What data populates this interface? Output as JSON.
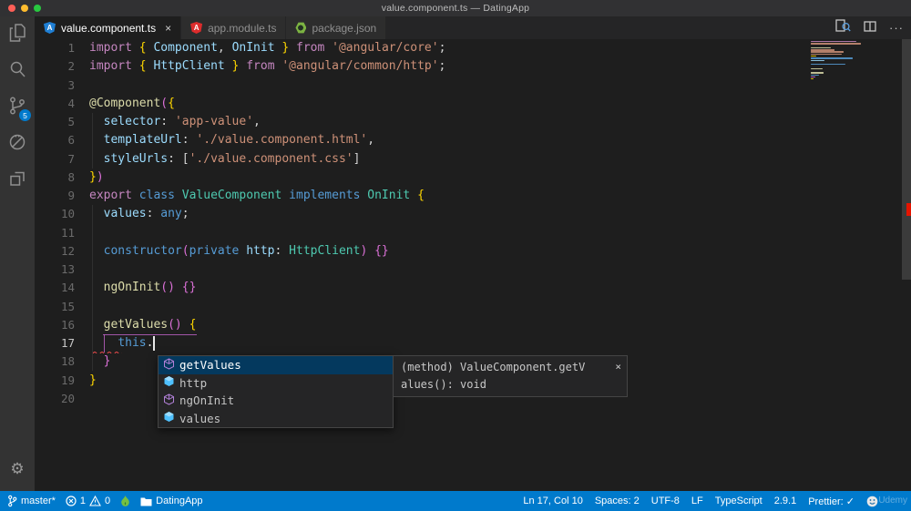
{
  "window": {
    "title": "value.component.ts — DatingApp"
  },
  "activity_bar": {
    "items": [
      {
        "name": "explorer"
      },
      {
        "name": "search"
      },
      {
        "name": "source-control",
        "badge": "5"
      },
      {
        "name": "debug"
      },
      {
        "name": "extensions"
      }
    ]
  },
  "tabs": [
    {
      "label": "value.component.ts",
      "close": "×",
      "active": true,
      "icon": "angular-blue",
      "icon_color": "#1f7fd4",
      "icon_letter": "A"
    },
    {
      "label": "app.module.ts",
      "active": false,
      "icon": "angular-red",
      "icon_color": "#dd2c2c",
      "icon_letter": "A"
    },
    {
      "label": "package.json",
      "active": false,
      "icon": "npm-green"
    }
  ],
  "editor_actions": {
    "more": "···"
  },
  "code": {
    "lines": [
      {
        "n": 1,
        "t": [
          [
            "kw",
            "import "
          ],
          [
            "b1",
            "{ "
          ],
          [
            "id",
            "Component"
          ],
          [
            "pl",
            ", "
          ],
          [
            "id",
            "OnInit"
          ],
          [
            "b1",
            " }"
          ],
          [
            "kw",
            " from "
          ],
          [
            "st",
            "'@angular/core'"
          ],
          [
            "pl",
            ";"
          ]
        ]
      },
      {
        "n": 2,
        "t": [
          [
            "kw",
            "import "
          ],
          [
            "b1",
            "{ "
          ],
          [
            "id",
            "HttpClient"
          ],
          [
            "b1",
            " }"
          ],
          [
            "kw",
            " from "
          ],
          [
            "st",
            "'@angular/common/http'"
          ],
          [
            "pl",
            ";"
          ]
        ]
      },
      {
        "n": 3,
        "t": []
      },
      {
        "n": 4,
        "t": [
          [
            "fn",
            "@Component"
          ],
          [
            "b2",
            "("
          ],
          [
            "b1",
            "{"
          ]
        ]
      },
      {
        "n": 5,
        "t": [
          [
            "pl",
            "  "
          ],
          [
            "id",
            "selector"
          ],
          [
            "pl",
            ": "
          ],
          [
            "st",
            "'app-value'"
          ],
          [
            "pl",
            ","
          ]
        ]
      },
      {
        "n": 6,
        "t": [
          [
            "pl",
            "  "
          ],
          [
            "id",
            "templateUrl"
          ],
          [
            "pl",
            ": "
          ],
          [
            "st",
            "'./value.component.html'"
          ],
          [
            "pl",
            ","
          ]
        ]
      },
      {
        "n": 7,
        "t": [
          [
            "pl",
            "  "
          ],
          [
            "id",
            "styleUrls"
          ],
          [
            "pl",
            ": ["
          ],
          [
            "st",
            "'./value.component.css'"
          ],
          [
            "pl",
            "]"
          ]
        ]
      },
      {
        "n": 8,
        "t": [
          [
            "b1",
            "}"
          ],
          [
            "b2",
            ")"
          ]
        ]
      },
      {
        "n": 9,
        "t": [
          [
            "kw",
            "export "
          ],
          [
            "k2",
            "class "
          ],
          [
            "ty",
            "ValueComponent "
          ],
          [
            "k2",
            "implements "
          ],
          [
            "ty",
            "OnInit "
          ],
          [
            "b1",
            "{"
          ]
        ]
      },
      {
        "n": 10,
        "t": [
          [
            "pl",
            "  "
          ],
          [
            "id",
            "values"
          ],
          [
            "pl",
            ": "
          ],
          [
            "k2",
            "any"
          ],
          [
            "pl",
            ";"
          ]
        ]
      },
      {
        "n": 11,
        "t": []
      },
      {
        "n": 12,
        "t": [
          [
            "pl",
            "  "
          ],
          [
            "k2",
            "constructor"
          ],
          [
            "b2",
            "("
          ],
          [
            "k2",
            "private "
          ],
          [
            "id",
            "http"
          ],
          [
            "pl",
            ": "
          ],
          [
            "ty",
            "HttpClient"
          ],
          [
            "b2",
            ")"
          ],
          [
            "pl",
            " "
          ],
          [
            "b2",
            "{}"
          ]
        ]
      },
      {
        "n": 13,
        "t": []
      },
      {
        "n": 14,
        "t": [
          [
            "pl",
            "  "
          ],
          [
            "fn",
            "ngOnInit"
          ],
          [
            "b2",
            "()"
          ],
          [
            "pl",
            " "
          ],
          [
            "b2",
            "{}"
          ]
        ]
      },
      {
        "n": 15,
        "t": []
      },
      {
        "n": 16,
        "t": [
          [
            "pl",
            "  "
          ],
          [
            "fn",
            "getValues"
          ],
          [
            "b2",
            "()"
          ],
          [
            "pl",
            " "
          ],
          [
            "b1",
            "{"
          ]
        ]
      },
      {
        "n": 17,
        "t": [
          [
            "pl",
            "    "
          ],
          [
            "k2",
            "this"
          ],
          [
            "pl",
            "."
          ]
        ],
        "active": true
      },
      {
        "n": 18,
        "t": [
          [
            "pl",
            "  "
          ],
          [
            "b2",
            "}"
          ]
        ]
      },
      {
        "n": 19,
        "t": [
          [
            "b1",
            "}"
          ]
        ]
      },
      {
        "n": 20,
        "t": []
      }
    ]
  },
  "suggest": {
    "items": [
      {
        "label": "getValues",
        "kind": "method",
        "selected": true
      },
      {
        "label": "http",
        "kind": "field",
        "selected": false
      },
      {
        "label": "ngOnInit",
        "kind": "method",
        "selected": false
      },
      {
        "label": "values",
        "kind": "field",
        "selected": false
      }
    ]
  },
  "docs": {
    "line1": "(method) ValueComponent.getV",
    "line2": "alues(): void",
    "close": "×"
  },
  "status_bar": {
    "branch": "master*",
    "errors": "1",
    "warnings": "0",
    "folder": "DatingApp",
    "right": [
      "Ln 17, Col 10",
      "Spaces: 2",
      "UTF-8",
      "LF",
      "TypeScript",
      "2.9.1",
      "Prettier: ✓"
    ]
  },
  "minimap": {
    "bars": [
      [
        50,
        "#c586c0"
      ],
      [
        55,
        "#ce9178"
      ],
      [
        0,
        ""
      ],
      [
        22,
        "#dcdcaa"
      ],
      [
        26,
        "#ce9178"
      ],
      [
        36,
        "#ce9178"
      ],
      [
        34,
        "#ce9178"
      ],
      [
        6,
        "#ffd700"
      ],
      [
        46,
        "#569cd6"
      ],
      [
        15,
        "#9cdcfe"
      ],
      [
        0,
        ""
      ],
      [
        38,
        "#569cd6"
      ],
      [
        0,
        ""
      ],
      [
        13,
        "#dcdcaa"
      ],
      [
        0,
        ""
      ],
      [
        14,
        "#dcdcaa"
      ],
      [
        9,
        "#569cd6"
      ],
      [
        5,
        "#da70d6"
      ],
      [
        3,
        "#ffd700"
      ],
      [
        0,
        ""
      ]
    ]
  },
  "watermark": "Udemy",
  "colors": {
    "status_bg": "#007acc",
    "editor_bg": "#1e1e1e",
    "traffic": [
      "#ff5f57",
      "#febc2e",
      "#28c840"
    ]
  }
}
